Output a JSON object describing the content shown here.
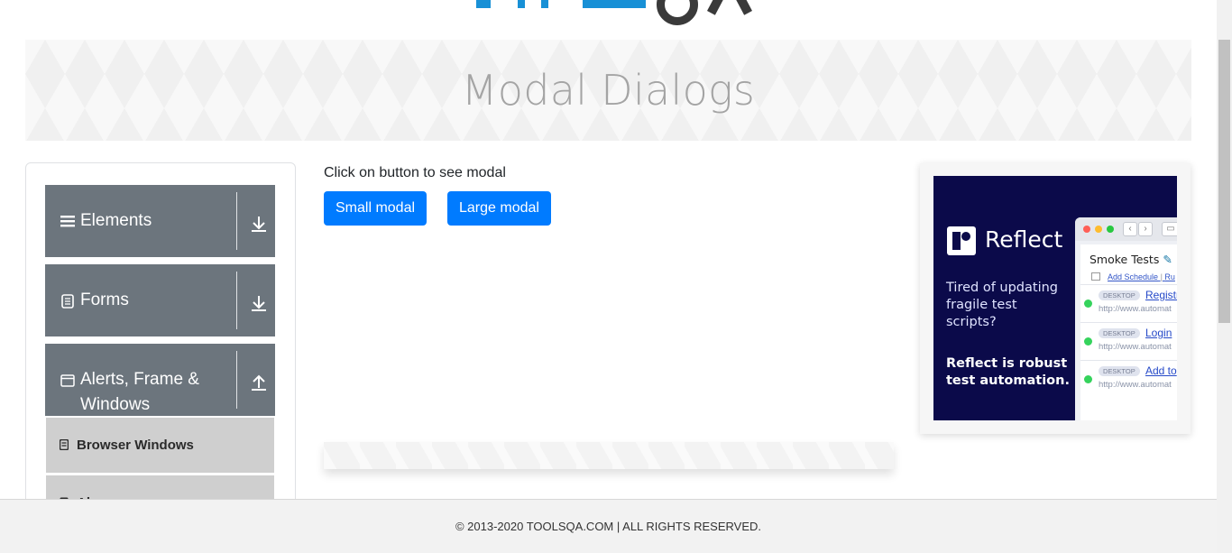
{
  "banner": {
    "title": "Modal Dialogs"
  },
  "sidebar": {
    "groups": [
      {
        "label": "Elements",
        "icon": "hamburger-icon",
        "action_icon": "download-arrow-icon"
      },
      {
        "label": "Forms",
        "icon": "document-icon",
        "action_icon": "download-arrow-icon"
      },
      {
        "label": "Alerts, Frame & Windows",
        "icon": "window-icon",
        "action_icon": "upload-arrow-icon"
      }
    ],
    "sub_items": [
      {
        "label": "Browser Windows",
        "icon": "document-small-icon"
      },
      {
        "label": "Al",
        "icon": "document-small-icon"
      }
    ]
  },
  "main": {
    "instruction": "Click on button to see modal",
    "small_modal_label": "Small modal",
    "large_modal_label": "Large modal"
  },
  "ad": {
    "brand": "Reflect",
    "tagline": "Tired of updating fragile test scripts?",
    "tagline2": "Reflect is robust test automation.",
    "window_title": "Smoke Tests",
    "add_schedule": "Add Schedule",
    "sched_extra": "Ru",
    "rows": [
      {
        "tag": "DESKTOP",
        "link": "Registr",
        "url": "http://www.automat"
      },
      {
        "tag": "DESKTOP",
        "link": "Login",
        "url": "http://www.automat"
      },
      {
        "tag": "DESKTOP",
        "link": "Add to",
        "url": "http://www.automat"
      }
    ]
  },
  "footer": {
    "text": "© 2013-2020 TOOLSQA.COM | ALL RIGHTS RESERVED."
  },
  "colors": {
    "primary": "#007bff",
    "sidebar_group": "#6c757d",
    "ad_bg": "#0b0a4a"
  }
}
